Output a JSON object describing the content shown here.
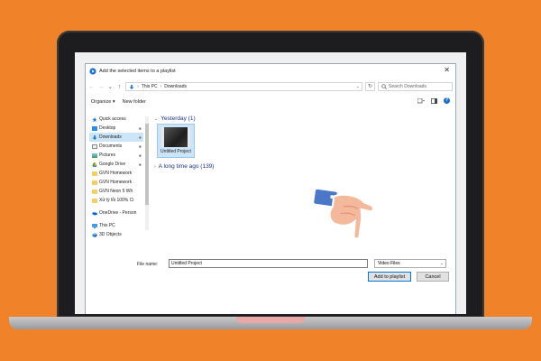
{
  "dialog": {
    "title": "Add the selected items to a playlist",
    "close_label": "✕"
  },
  "address": {
    "back": "←",
    "forward": "→",
    "recent": "⌄",
    "up": "↑",
    "crumbs": [
      "This PC",
      "Downloads"
    ],
    "separator": "›",
    "refresh": "↻"
  },
  "search": {
    "placeholder": "Search Downloads"
  },
  "toolbar": {
    "organize_label": "Organize ▾",
    "new_folder_label": "New folder",
    "help_label": "?"
  },
  "sidebar": {
    "items": [
      {
        "label": "Quick access",
        "icon": "star-icon"
      },
      {
        "label": "Desktop",
        "icon": "desktop-icon",
        "pinned": true
      },
      {
        "label": "Downloads",
        "icon": "download-icon",
        "pinned": true,
        "selected": true
      },
      {
        "label": "Documents",
        "icon": "document-icon",
        "pinned": true
      },
      {
        "label": "Pictures",
        "icon": "picture-icon",
        "pinned": true
      },
      {
        "label": "Google Drive",
        "icon": "google-drive-icon",
        "pinned": true
      },
      {
        "label": "GVN Homework",
        "icon": "folder-icon"
      },
      {
        "label": "GVN Homework",
        "icon": "folder-icon"
      },
      {
        "label": "GVN Neon 5 Wh",
        "icon": "folder-icon"
      },
      {
        "label": "Xử lý lỗi 100% Ci",
        "icon": "folder-icon"
      },
      {
        "label": "OneDrive - Person",
        "icon": "onedrive-icon"
      },
      {
        "label": "This PC",
        "icon": "computer-icon"
      },
      {
        "label": "3D Objects",
        "icon": "cube-icon"
      }
    ],
    "pin_glyph": "📌"
  },
  "content": {
    "groups": [
      {
        "label": "Yesterday (1)",
        "expanded": true
      },
      {
        "label": "A long time ago (139)",
        "expanded": false
      }
    ],
    "files": [
      {
        "name": "Untitled Project"
      }
    ]
  },
  "bottom": {
    "filename_label": "File name:",
    "filename_value": "Untitled Project",
    "filetype_value": "Video Files",
    "add_button": "Add to playlist",
    "cancel_button": "Cancel"
  },
  "colors": {
    "background": "#f0832a",
    "selection": "#cce4f7",
    "accent": "#0078d7",
    "group_header": "#1e3287"
  }
}
